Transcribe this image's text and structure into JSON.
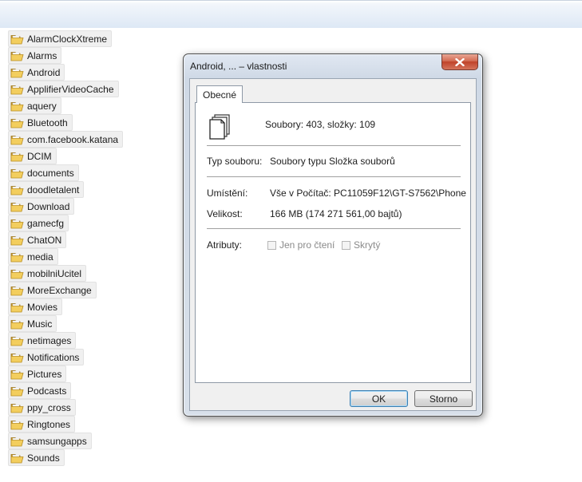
{
  "folders": [
    "AlarmClockXtreme",
    "Alarms",
    "Android",
    "ApplifierVideoCache",
    "aquery",
    "Bluetooth",
    "com.facebook.katana",
    "DCIM",
    "documents",
    "doodletalent",
    "Download",
    "gamecfg",
    "ChatON",
    "media",
    "mobilniUcitel",
    "MoreExchange",
    "Movies",
    "Music",
    "netimages",
    "Notifications",
    "Pictures",
    "Podcasts",
    "ppy_cross",
    "Ringtones",
    "samsungapps",
    "Sounds"
  ],
  "dialog": {
    "title": "Android, ... – vlastnosti",
    "tab": "Obecné",
    "summary": "Soubory: 403, složky: 109",
    "type_label": "Typ souboru:",
    "type_value": "Soubory typu Složka souborů",
    "location_label": "Umístění:",
    "location_value": "Vše v Počítač: PC11059F12\\GT-S7562\\Phone",
    "size_label": "Velikost:",
    "size_value": "166 MB (174 271 561,00 bajtů)",
    "attributes_label": "Atributy:",
    "readonly_label": "Jen pro čtení",
    "hidden_label": "Skrytý",
    "ok_label": "OK",
    "cancel_label": "Storno"
  }
}
